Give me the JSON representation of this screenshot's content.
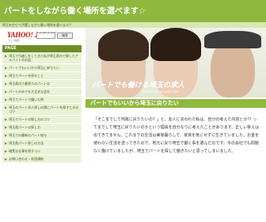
{
  "site": {
    "title": "パートをしながら働く場所を選べます☆",
    "tagline": "埼玉を住むで活躍しながら働く場所を選べます!!"
  },
  "search": {
    "logo": "YAHOO! JAPAN",
    "logo_sub": "ウェブ検索",
    "placeholder": "",
    "button_label": "検索"
  },
  "sidebar": {
    "header": "PAGE",
    "items": [
      {
        "label": "埼玉で引越しをしてきた私が埼玉県内で探したアルバイトのお話"
      },
      {
        "label": "パートでもいいから埼玉に戻りたい"
      },
      {
        "label": "埼玉でパートを探すこと"
      },
      {
        "label": "埼玉県内で最寄りのパートは"
      },
      {
        "label": "パートのみでも大丈夫な会社"
      },
      {
        "label": "埼玉でパートで働いた時"
      },
      {
        "label": "埼玉のパート求人探しの際にパートを探すときのコツ"
      },
      {
        "label": "埼玉でパートの探し方のコツ"
      },
      {
        "label": "埼玉県パートの探し方"
      },
      {
        "label": "埼玉での最新のパート給与"
      },
      {
        "label": "埼玉県パート探しの方法"
      },
      {
        "label": "確実な仕事を探すコツ"
      },
      {
        "label": "お問い合わせ・利用規約"
      }
    ]
  },
  "banner": {
    "headline": "パートでも働ける埼玉の求人",
    "url_text": "www.saitama-part.com"
  },
  "main": {
    "heading": "パートでもいいから埼玉に戻りたい",
    "body": "「そこまでして何故に戻りたいの？」と、友人に言われた私は、自分の考えた内容とか?? ってまでして埼玉に戻りたいのかという理由を自分なりに考えたことがあります。正しい答えは出てきてません。これまでの生活は実家暮らしで、家賃を気にせずに生きていました。お金を使わない生活を送ってきたので、地元に戻り埼玉で働く事を選んだのです。今の会社でも問題なく働けていましたが、埼玉でパートを探して働きたいと思ってしまいました。"
  }
}
